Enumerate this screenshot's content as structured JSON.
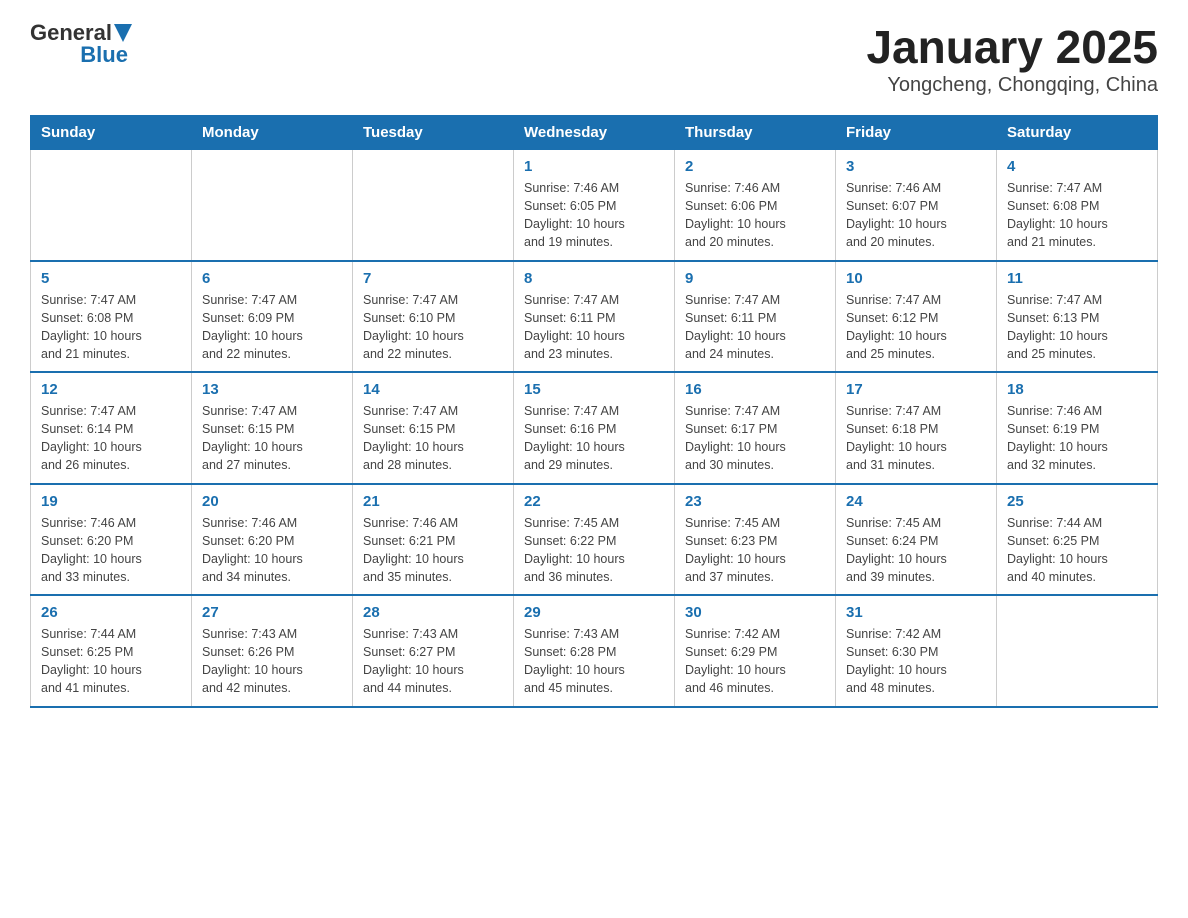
{
  "logo": {
    "text_general": "General",
    "text_blue": "Blue"
  },
  "title": "January 2025",
  "subtitle": "Yongcheng, Chongqing, China",
  "days_header": [
    "Sunday",
    "Monday",
    "Tuesday",
    "Wednesday",
    "Thursday",
    "Friday",
    "Saturday"
  ],
  "weeks": [
    [
      {
        "day": "",
        "info": ""
      },
      {
        "day": "",
        "info": ""
      },
      {
        "day": "",
        "info": ""
      },
      {
        "day": "1",
        "info": "Sunrise: 7:46 AM\nSunset: 6:05 PM\nDaylight: 10 hours\nand 19 minutes."
      },
      {
        "day": "2",
        "info": "Sunrise: 7:46 AM\nSunset: 6:06 PM\nDaylight: 10 hours\nand 20 minutes."
      },
      {
        "day": "3",
        "info": "Sunrise: 7:46 AM\nSunset: 6:07 PM\nDaylight: 10 hours\nand 20 minutes."
      },
      {
        "day": "4",
        "info": "Sunrise: 7:47 AM\nSunset: 6:08 PM\nDaylight: 10 hours\nand 21 minutes."
      }
    ],
    [
      {
        "day": "5",
        "info": "Sunrise: 7:47 AM\nSunset: 6:08 PM\nDaylight: 10 hours\nand 21 minutes."
      },
      {
        "day": "6",
        "info": "Sunrise: 7:47 AM\nSunset: 6:09 PM\nDaylight: 10 hours\nand 22 minutes."
      },
      {
        "day": "7",
        "info": "Sunrise: 7:47 AM\nSunset: 6:10 PM\nDaylight: 10 hours\nand 22 minutes."
      },
      {
        "day": "8",
        "info": "Sunrise: 7:47 AM\nSunset: 6:11 PM\nDaylight: 10 hours\nand 23 minutes."
      },
      {
        "day": "9",
        "info": "Sunrise: 7:47 AM\nSunset: 6:11 PM\nDaylight: 10 hours\nand 24 minutes."
      },
      {
        "day": "10",
        "info": "Sunrise: 7:47 AM\nSunset: 6:12 PM\nDaylight: 10 hours\nand 25 minutes."
      },
      {
        "day": "11",
        "info": "Sunrise: 7:47 AM\nSunset: 6:13 PM\nDaylight: 10 hours\nand 25 minutes."
      }
    ],
    [
      {
        "day": "12",
        "info": "Sunrise: 7:47 AM\nSunset: 6:14 PM\nDaylight: 10 hours\nand 26 minutes."
      },
      {
        "day": "13",
        "info": "Sunrise: 7:47 AM\nSunset: 6:15 PM\nDaylight: 10 hours\nand 27 minutes."
      },
      {
        "day": "14",
        "info": "Sunrise: 7:47 AM\nSunset: 6:15 PM\nDaylight: 10 hours\nand 28 minutes."
      },
      {
        "day": "15",
        "info": "Sunrise: 7:47 AM\nSunset: 6:16 PM\nDaylight: 10 hours\nand 29 minutes."
      },
      {
        "day": "16",
        "info": "Sunrise: 7:47 AM\nSunset: 6:17 PM\nDaylight: 10 hours\nand 30 minutes."
      },
      {
        "day": "17",
        "info": "Sunrise: 7:47 AM\nSunset: 6:18 PM\nDaylight: 10 hours\nand 31 minutes."
      },
      {
        "day": "18",
        "info": "Sunrise: 7:46 AM\nSunset: 6:19 PM\nDaylight: 10 hours\nand 32 minutes."
      }
    ],
    [
      {
        "day": "19",
        "info": "Sunrise: 7:46 AM\nSunset: 6:20 PM\nDaylight: 10 hours\nand 33 minutes."
      },
      {
        "day": "20",
        "info": "Sunrise: 7:46 AM\nSunset: 6:20 PM\nDaylight: 10 hours\nand 34 minutes."
      },
      {
        "day": "21",
        "info": "Sunrise: 7:46 AM\nSunset: 6:21 PM\nDaylight: 10 hours\nand 35 minutes."
      },
      {
        "day": "22",
        "info": "Sunrise: 7:45 AM\nSunset: 6:22 PM\nDaylight: 10 hours\nand 36 minutes."
      },
      {
        "day": "23",
        "info": "Sunrise: 7:45 AM\nSunset: 6:23 PM\nDaylight: 10 hours\nand 37 minutes."
      },
      {
        "day": "24",
        "info": "Sunrise: 7:45 AM\nSunset: 6:24 PM\nDaylight: 10 hours\nand 39 minutes."
      },
      {
        "day": "25",
        "info": "Sunrise: 7:44 AM\nSunset: 6:25 PM\nDaylight: 10 hours\nand 40 minutes."
      }
    ],
    [
      {
        "day": "26",
        "info": "Sunrise: 7:44 AM\nSunset: 6:25 PM\nDaylight: 10 hours\nand 41 minutes."
      },
      {
        "day": "27",
        "info": "Sunrise: 7:43 AM\nSunset: 6:26 PM\nDaylight: 10 hours\nand 42 minutes."
      },
      {
        "day": "28",
        "info": "Sunrise: 7:43 AM\nSunset: 6:27 PM\nDaylight: 10 hours\nand 44 minutes."
      },
      {
        "day": "29",
        "info": "Sunrise: 7:43 AM\nSunset: 6:28 PM\nDaylight: 10 hours\nand 45 minutes."
      },
      {
        "day": "30",
        "info": "Sunrise: 7:42 AM\nSunset: 6:29 PM\nDaylight: 10 hours\nand 46 minutes."
      },
      {
        "day": "31",
        "info": "Sunrise: 7:42 AM\nSunset: 6:30 PM\nDaylight: 10 hours\nand 48 minutes."
      },
      {
        "day": "",
        "info": ""
      }
    ]
  ]
}
